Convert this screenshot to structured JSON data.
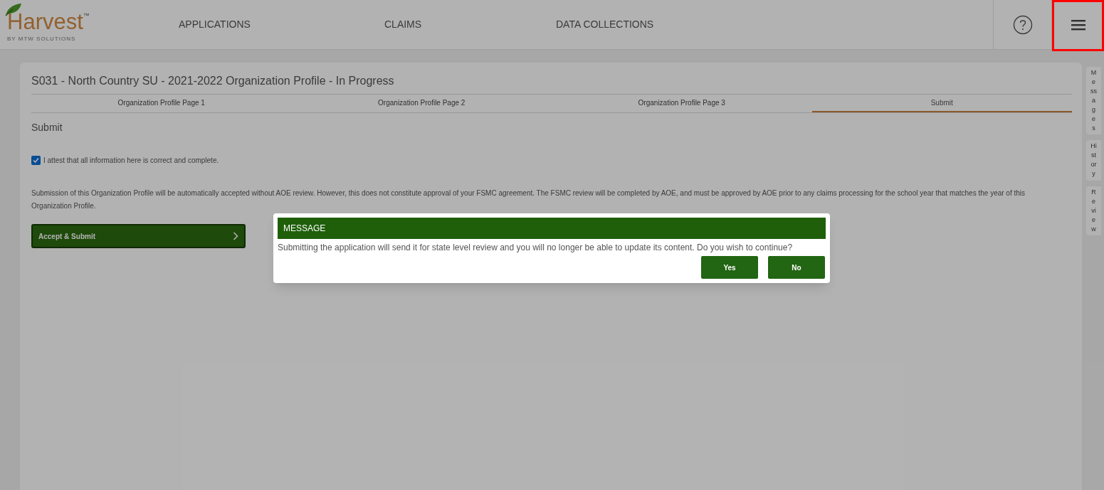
{
  "header": {
    "logo": {
      "name": "Harvest",
      "mark": "™",
      "tagline": "BY MTW SOLUTIONS"
    },
    "nav": [
      {
        "label": "APPLICATIONS"
      },
      {
        "label": "CLAIMS"
      },
      {
        "label": "DATA COLLECTIONS"
      }
    ],
    "menu_highlighted": true
  },
  "page": {
    "title": "S031 - North Country SU - 2021-2022 Organization Profile - In Progress",
    "tabs": [
      {
        "label": "Organization Profile Page 1",
        "selected": false
      },
      {
        "label": "Organization Profile Page 2",
        "selected": false
      },
      {
        "label": "Organization Profile Page 3",
        "selected": false
      },
      {
        "label": "Submit",
        "selected": true
      }
    ],
    "section": "Submit",
    "attest": {
      "label": "I attest that all information here is correct and complete.",
      "checked": true
    },
    "notice": "Submission of this Organization Profile will be automatically accepted without AOE review. However, this does not constitute approval of your FSMC agreement. The FSMC review will be completed by AOE, and must be approved by AOE prior to any claims processing for the school year that matches the year of this Organization Profile.",
    "submit_button": "Accept & Submit"
  },
  "side_tabs": [
    "Messages",
    "History",
    "Review"
  ],
  "dialog": {
    "title": "MESSAGE",
    "text": "Submitting the application will send it for state level review and you will no longer be able to update its content. Do you wish to continue?",
    "buttons": [
      "Yes",
      "No"
    ]
  }
}
